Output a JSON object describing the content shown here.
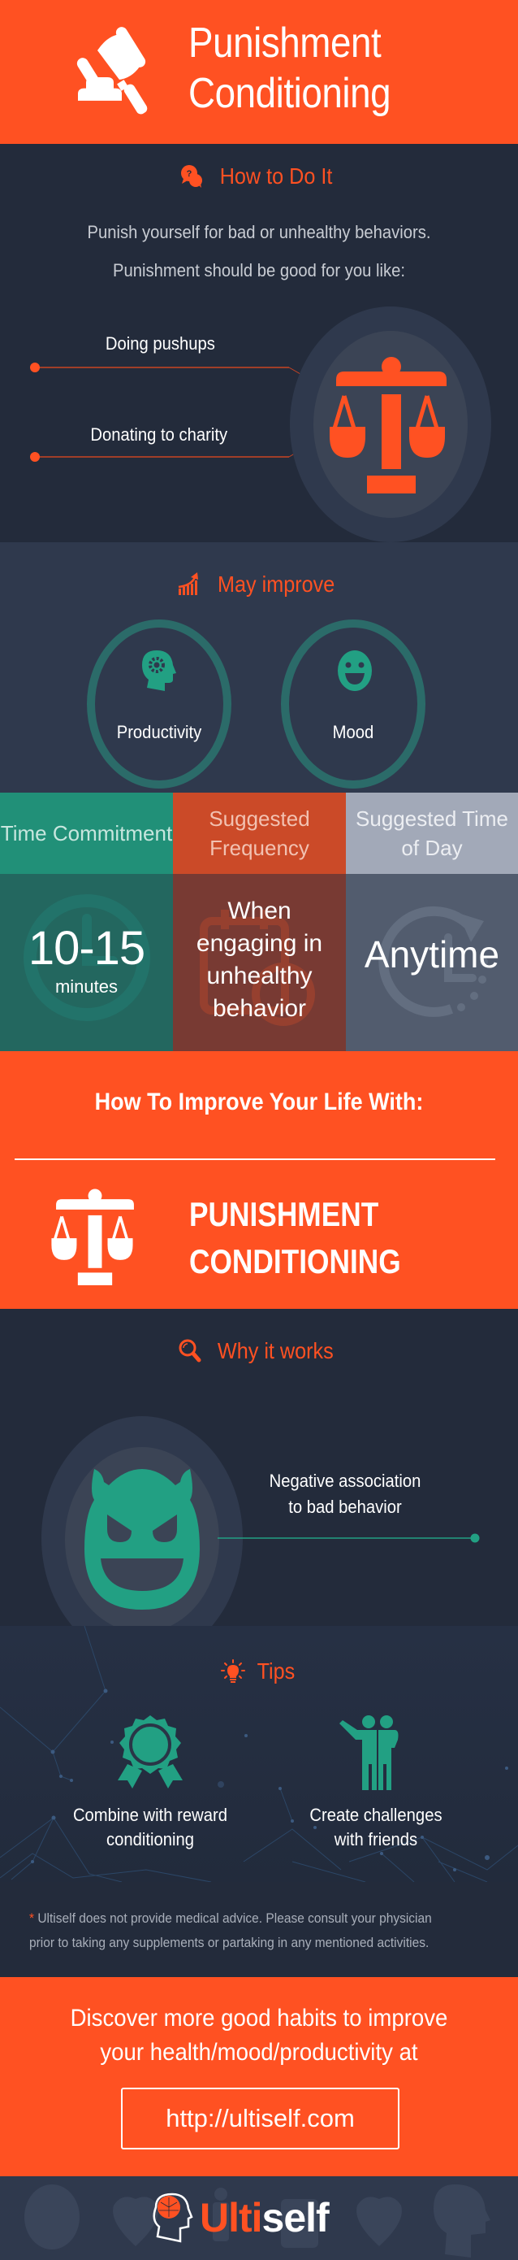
{
  "colors": {
    "brand_orange": "#ff5122",
    "teal": "#22a083",
    "dark_navy": "#232b3b",
    "slate": "#2f394d",
    "header_teal": "#219078",
    "header_rust": "#cb4a28",
    "header_gray": "#a2a9b8",
    "body_teal": "#23675f",
    "body_rust": "#783a33",
    "body_gray": "#525c6e"
  },
  "header": {
    "icon": "gavel-icon",
    "title_line1": "Punishment",
    "title_line2": "Conditioning"
  },
  "how_to": {
    "icon": "question-chat-icon",
    "heading": "How to Do It",
    "intro_line1": "Punish yourself for bad or unhealthy behaviors.",
    "intro_line2": "Punishment should be good for you like:",
    "examples": [
      "Doing pushups",
      "Donating to charity"
    ],
    "center_icon": "scales-icon"
  },
  "may_improve": {
    "icon": "growth-chart-icon",
    "heading": "May improve",
    "items": [
      {
        "label": "Productivity",
        "icon": "head-gear-icon"
      },
      {
        "label": "Mood",
        "icon": "smiley-icon"
      }
    ]
  },
  "stats": [
    {
      "header": "Time Commitment",
      "value": "10-15",
      "unit": "minutes",
      "bg_icon": "clock-icon"
    },
    {
      "header": "Suggested Frequency",
      "value": "When engaging in unhealthy behavior",
      "bg_icon": "calendar-icon"
    },
    {
      "header": "Suggested Time of Day",
      "value": "Anytime",
      "bg_icon": "clock-rotate-icon"
    }
  ],
  "banner": {
    "title": "How To Improve Your Life With:",
    "name_line1": "PUNISHMENT",
    "name_line2": "CONDITIONING",
    "icon": "scales-icon"
  },
  "why_it_works": {
    "icon": "magnifier-icon",
    "heading": "Why it works",
    "point_line1": "Negative association",
    "point_line2": "to bad behavior",
    "center_icon": "devil-face-icon"
  },
  "tips": {
    "icon": "lightbulb-icon",
    "heading": "Tips",
    "items": [
      {
        "line1": "Combine with reward",
        "line2": "conditioning",
        "icon": "award-ribbon-icon"
      },
      {
        "line1": "Create challenges",
        "line2": "with friends",
        "icon": "friends-icon"
      }
    ]
  },
  "disclaimer": {
    "asterisk": "*",
    "line1": "Ultiself does not provide medical advice. Please consult your physician",
    "line2": "prior to taking any supplements or partaking in any mentioned activities."
  },
  "cta": {
    "line1": "Discover more good habits to improve",
    "line2": "your health/mood/productivity at",
    "link_label": "http://ultiself.com"
  },
  "footer": {
    "logo_part1": "Ulti",
    "logo_part2": "self",
    "logo_icon": "brain-head-icon"
  }
}
